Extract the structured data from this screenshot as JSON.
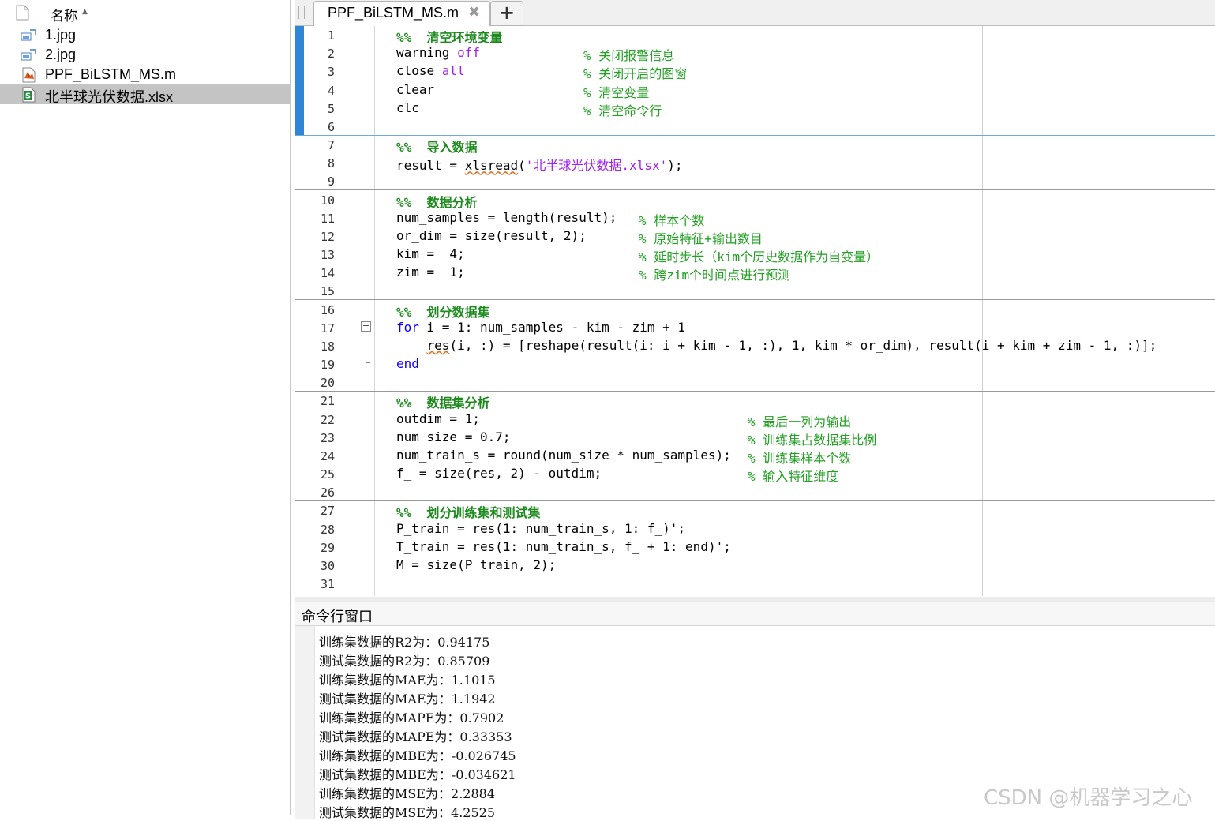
{
  "browser": {
    "header_label": "名称",
    "files": [
      {
        "name": "1.jpg",
        "icon": "image-file-icon",
        "selected": false
      },
      {
        "name": "2.jpg",
        "icon": "image-file-icon",
        "selected": false
      },
      {
        "name": "PPF_BiLSTM_MS.m",
        "icon": "matlab-script-icon",
        "selected": false
      },
      {
        "name": "北半球光伏数据.xlsx",
        "icon": "excel-file-icon",
        "selected": true
      }
    ]
  },
  "editor": {
    "tab_title": "PPF_BiLSTM_MS.m",
    "tab_close": "✖",
    "tab_add": "+",
    "lines": [
      {
        "n": "1",
        "parts": [
          [
            "sec",
            "%%  清空环境变量"
          ]
        ]
      },
      {
        "n": "2",
        "parts": [
          [
            "plain",
            "warning "
          ],
          [
            "str",
            "off"
          ]
        ],
        "comment": "% 关闭报警信息",
        "comment_col": 237
      },
      {
        "n": "3",
        "parts": [
          [
            "plain",
            "close "
          ],
          [
            "str",
            "all"
          ]
        ],
        "comment": "% 关闭开启的图窗",
        "comment_col": 237
      },
      {
        "n": "4",
        "parts": [
          [
            "plain",
            "clear"
          ]
        ],
        "comment": "% 清空变量",
        "comment_col": 237
      },
      {
        "n": "5",
        "parts": [
          [
            "plain",
            "clc"
          ]
        ],
        "comment": "% 清空命令行",
        "comment_col": 237
      },
      {
        "n": "6",
        "parts": []
      },
      {
        "n": "7",
        "parts": [
          [
            "sec",
            "%%  导入数据"
          ]
        ]
      },
      {
        "n": "8",
        "parts": [
          [
            "plain",
            "result = "
          ],
          [
            "sq",
            "xlsread"
          ],
          [
            "plain",
            "("
          ],
          [
            "str",
            "'北半球光伏数据.xlsx'"
          ],
          [
            "plain",
            ");"
          ]
        ]
      },
      {
        "n": "9",
        "parts": []
      },
      {
        "n": "10",
        "parts": [
          [
            "sec",
            "%%  数据分析"
          ]
        ]
      },
      {
        "n": "11",
        "parts": [
          [
            "plain",
            "num_samples = length(result);"
          ]
        ],
        "comment": "% 样本个数",
        "comment_col": 307
      },
      {
        "n": "12",
        "parts": [
          [
            "plain",
            "or_dim = size(result, 2);"
          ]
        ],
        "comment": "% 原始特征+输出数目",
        "comment_col": 307
      },
      {
        "n": "13",
        "parts": [
          [
            "plain",
            "kim =  4;"
          ]
        ],
        "comment": "% 延时步长（kim个历史数据作为自变量）",
        "comment_col": 307
      },
      {
        "n": "14",
        "parts": [
          [
            "plain",
            "zim =  1;"
          ]
        ],
        "comment": "% 跨zim个时间点进行预测",
        "comment_col": 307
      },
      {
        "n": "15",
        "parts": []
      },
      {
        "n": "16",
        "parts": [
          [
            "sec",
            "%%  划分数据集"
          ]
        ]
      },
      {
        "n": "17",
        "parts": [
          [
            "kw",
            "for"
          ],
          [
            "plain",
            " i = 1: num_samples - kim - zim + 1"
          ]
        ]
      },
      {
        "n": "18",
        "parts": [
          [
            "plain",
            "    "
          ],
          [
            "sq",
            "res"
          ],
          [
            "plain",
            "(i, :) = [reshape(result(i: i + kim - 1, :), 1, kim * or_dim), result(i + kim + zim - 1, :)];"
          ]
        ]
      },
      {
        "n": "19",
        "parts": [
          [
            "kw",
            "end"
          ]
        ]
      },
      {
        "n": "20",
        "parts": []
      },
      {
        "n": "21",
        "parts": [
          [
            "sec",
            "%%  数据集分析"
          ]
        ]
      },
      {
        "n": "22",
        "parts": [
          [
            "plain",
            "outdim = 1;"
          ]
        ],
        "comment": "% 最后一列为输出",
        "comment_col": 445
      },
      {
        "n": "23",
        "parts": [
          [
            "plain",
            "num_size = 0.7;"
          ]
        ],
        "comment": "% 训练集占数据集比例",
        "comment_col": 445
      },
      {
        "n": "24",
        "parts": [
          [
            "plain",
            "num_train_s = round(num_size * num_samples);"
          ]
        ],
        "comment": "% 训练集样本个数",
        "comment_col": 445
      },
      {
        "n": "25",
        "parts": [
          [
            "plain",
            "f_ = size(res, 2) - outdim;"
          ]
        ],
        "comment": "% 输入特征维度",
        "comment_col": 445
      },
      {
        "n": "26",
        "parts": []
      },
      {
        "n": "27",
        "parts": [
          [
            "sec",
            "%%  划分训练集和测试集"
          ]
        ]
      },
      {
        "n": "28",
        "parts": [
          [
            "plain",
            "P_train = res(1: num_train_s, 1: f_)';"
          ]
        ]
      },
      {
        "n": "29",
        "parts": [
          [
            "plain",
            "T_train = res(1: num_train_s, f_ + 1: end)';"
          ]
        ]
      },
      {
        "n": "30",
        "parts": [
          [
            "plain",
            "M = size(P_train, 2);"
          ]
        ]
      },
      {
        "n": "31",
        "parts": []
      }
    ]
  },
  "command_window": {
    "title": "命令行窗口",
    "output": [
      "训练集数据的R2为：0.94175",
      "测试集数据的R2为：0.85709",
      "训练集数据的MAE为：1.1015",
      "测试集数据的MAE为：1.1942",
      "训练集数据的MAPE为：0.7902",
      "测试集数据的MAPE为：0.33353",
      "训练集数据的MBE为：-0.026745",
      "测试集数据的MBE为：-0.034621",
      "训练集数据的MSE为：2.2884",
      "测试集数据的MSE为：4.2525"
    ]
  },
  "watermark": "CSDN @机器学习之心",
  "colors": {
    "accent": "#2f86d6",
    "comment": "#22a022",
    "keyword": "#0e00ff",
    "string": "#a020f0",
    "selection": "#c4c4c4"
  }
}
